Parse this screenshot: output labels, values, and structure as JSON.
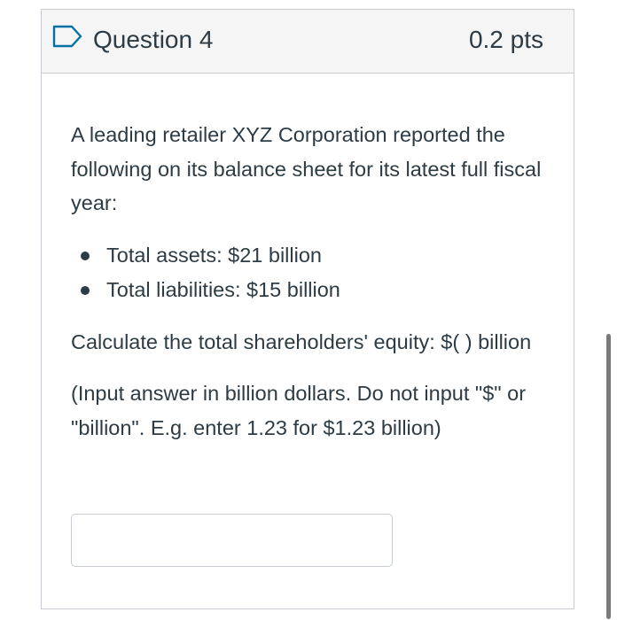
{
  "question": {
    "title": "Question 4",
    "points": "0.2 pts",
    "intro": "A leading retailer XYZ Corporation reported the following on its balance sheet for its latest full fiscal year:",
    "bullets": [
      {
        "label": "Total assets: $21 billion"
      },
      {
        "label": "Total liabilities: $15 billion"
      }
    ],
    "prompt": "Calculate the total shareholders' equity: $(   ) billion",
    "instructions": "(Input answer in billion dollars. Do not input \"$\" or \"billion\". E.g. enter 1.23 for $1.23 billion)",
    "answer": {
      "value": "",
      "placeholder": ""
    }
  },
  "icons": {
    "flag": "flag-outline-icon"
  },
  "colors": {
    "text": "#2d3b45",
    "border": "#c7cdd1",
    "header_bg": "#f5f5f5",
    "flag": "#0770a3"
  }
}
